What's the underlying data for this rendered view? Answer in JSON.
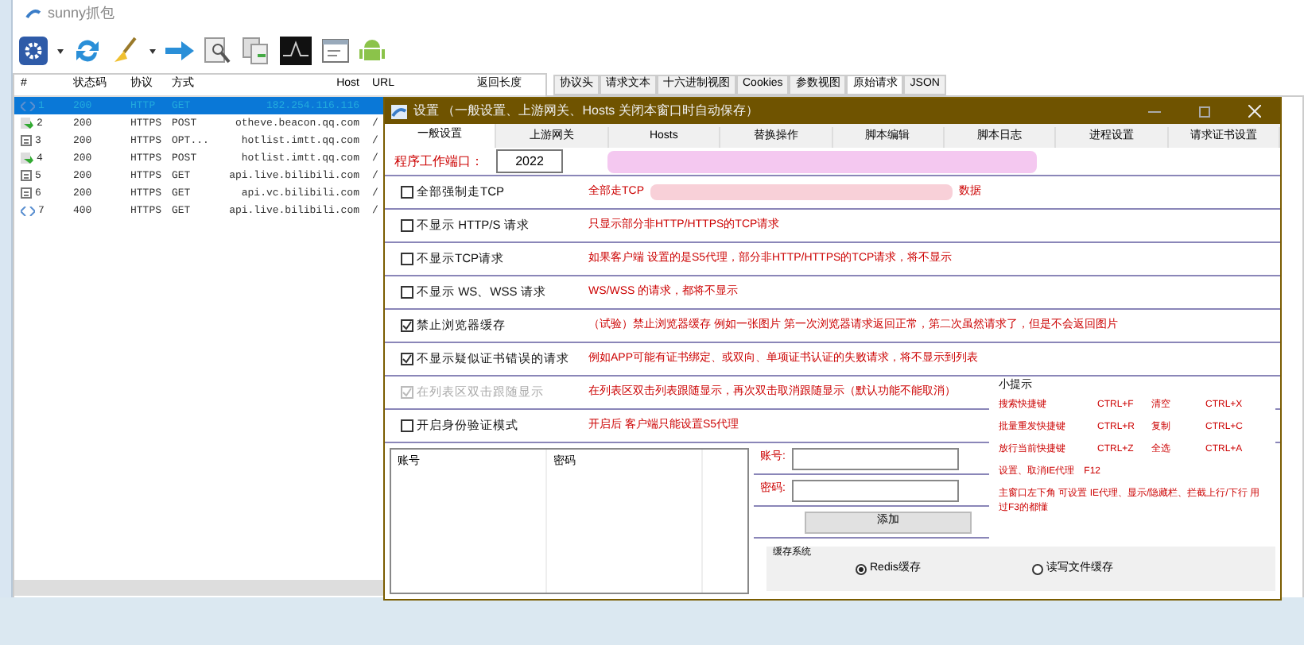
{
  "window": {
    "title": "sunny抓包"
  },
  "list": {
    "columns": [
      "#",
      "状态码",
      "协议",
      "方式",
      "Host",
      "URL",
      "返回长度"
    ],
    "rows": [
      {
        "kind": "ws",
        "num": "1",
        "status": "200",
        "protocol": "HTTP",
        "method": "GET",
        "host": "182.254.116.116",
        "url": "",
        "selected": true
      },
      {
        "kind": "ok",
        "num": "2",
        "status": "200",
        "protocol": "HTTPS",
        "method": "POST",
        "host": "otheve.beacon.qq.com",
        "url": "/",
        "selected": false
      },
      {
        "kind": "doc",
        "num": "3",
        "status": "200",
        "protocol": "HTTPS",
        "method": "OPT...",
        "host": "hotlist.imtt.qq.com",
        "url": "/",
        "selected": false
      },
      {
        "kind": "ok",
        "num": "4",
        "status": "200",
        "protocol": "HTTPS",
        "method": "POST",
        "host": "hotlist.imtt.qq.com",
        "url": "/",
        "selected": false
      },
      {
        "kind": "doc",
        "num": "5",
        "status": "200",
        "protocol": "HTTPS",
        "method": "GET",
        "host": "api.live.bilibili.com",
        "url": "/",
        "selected": false
      },
      {
        "kind": "doc",
        "num": "6",
        "status": "200",
        "protocol": "HTTPS",
        "method": "GET",
        "host": "api.vc.bilibili.com",
        "url": "/",
        "selected": false
      },
      {
        "kind": "ws",
        "num": "7",
        "status": "400",
        "protocol": "HTTPS",
        "method": "GET",
        "host": "api.live.bilibili.com",
        "url": "/",
        "selected": false
      }
    ]
  },
  "detail_tabs": [
    {
      "label": "协议头",
      "selected": false
    },
    {
      "label": "请求文本",
      "selected": false
    },
    {
      "label": "十六进制视图",
      "selected": false
    },
    {
      "label": "Cookies",
      "selected": false
    },
    {
      "label": "参数视图",
      "selected": false
    },
    {
      "label": "原始请求",
      "selected": true
    },
    {
      "label": "JSON",
      "selected": false
    }
  ],
  "dialog": {
    "title": "设置 （一般设置、上游网关、Hosts 关闭本窗口时自动保存）",
    "tabs": [
      {
        "label": "一般设置",
        "selected": true
      },
      {
        "label": "上游网关",
        "selected": false
      },
      {
        "label": "Hosts",
        "selected": false
      },
      {
        "label": "替换操作",
        "selected": false
      },
      {
        "label": "脚本编辑",
        "selected": false
      },
      {
        "label": "脚本日志",
        "selected": false
      },
      {
        "label": "进程设置",
        "selected": false
      },
      {
        "label": "请求证书设置",
        "selected": false
      }
    ],
    "port": {
      "label": "程序工作端口：",
      "value": "2022"
    },
    "options": [
      {
        "label": "全部强制走TCP",
        "checked": false,
        "disabled": false,
        "desc": "全部走TCP",
        "desc_tail": "数据"
      },
      {
        "label": "不显示 HTTP/S 请求",
        "checked": false,
        "disabled": false,
        "desc": "只显示部分非HTTP/HTTPS的TCP请求"
      },
      {
        "label": "不显示TCP请求",
        "checked": false,
        "disabled": false,
        "desc": "如果客户端 设置的是S5代理，部分非HTTP/HTTPS的TCP请求，将不显示"
      },
      {
        "label": "不显示 WS、WSS 请求",
        "checked": false,
        "disabled": false,
        "desc": "WS/WSS 的请求，都将不显示"
      },
      {
        "label": "禁止浏览器缓存",
        "checked": true,
        "disabled": false,
        "desc": "（试验）禁止浏览器缓存 例如一张图片 第一次浏览器请求返回正常，第二次虽然请求了，但是不会返回图片"
      },
      {
        "label": "不显示疑似证书错误的请求",
        "checked": true,
        "disabled": false,
        "desc": "例如APP可能有证书绑定、或双向、单项证书认证的失败请求，将不显示到列表"
      },
      {
        "label": "在列表区双击跟随显示",
        "checked": true,
        "disabled": true,
        "desc": "在列表区双击列表跟随显示，再次双击取消跟随显示（默认功能不能取消）"
      },
      {
        "label": "开启身份验证模式",
        "checked": false,
        "disabled": false,
        "desc": "开启后 客户端只能设置S5代理"
      }
    ],
    "accounts": {
      "columns": [
        "账号",
        "密码"
      ]
    },
    "form": {
      "user_label": "账号:",
      "pass_label": "密码:",
      "add_button": "添加"
    },
    "tips": {
      "title": "小提示",
      "shortcuts": [
        [
          "搜索快捷键",
          "CTRL+F",
          "清空",
          "CTRL+X"
        ],
        [
          "批量重发快捷键",
          "CTRL+R",
          "复制",
          "CTRL+C"
        ],
        [
          "放行当前快捷键",
          "CTRL+Z",
          "全选",
          "CTRL+A"
        ]
      ],
      "lines": [
        "设置、取消IE代理　F12",
        "主窗口左下角 可设置 IE代理、显示/隐藏栏、拦截上行/下行 用过F3的都懂"
      ]
    },
    "cache": {
      "title": "缓存系统",
      "options": [
        {
          "label": "Redis缓存",
          "selected": true
        },
        {
          "label": "读写文件缓存",
          "selected": false
        }
      ]
    }
  }
}
